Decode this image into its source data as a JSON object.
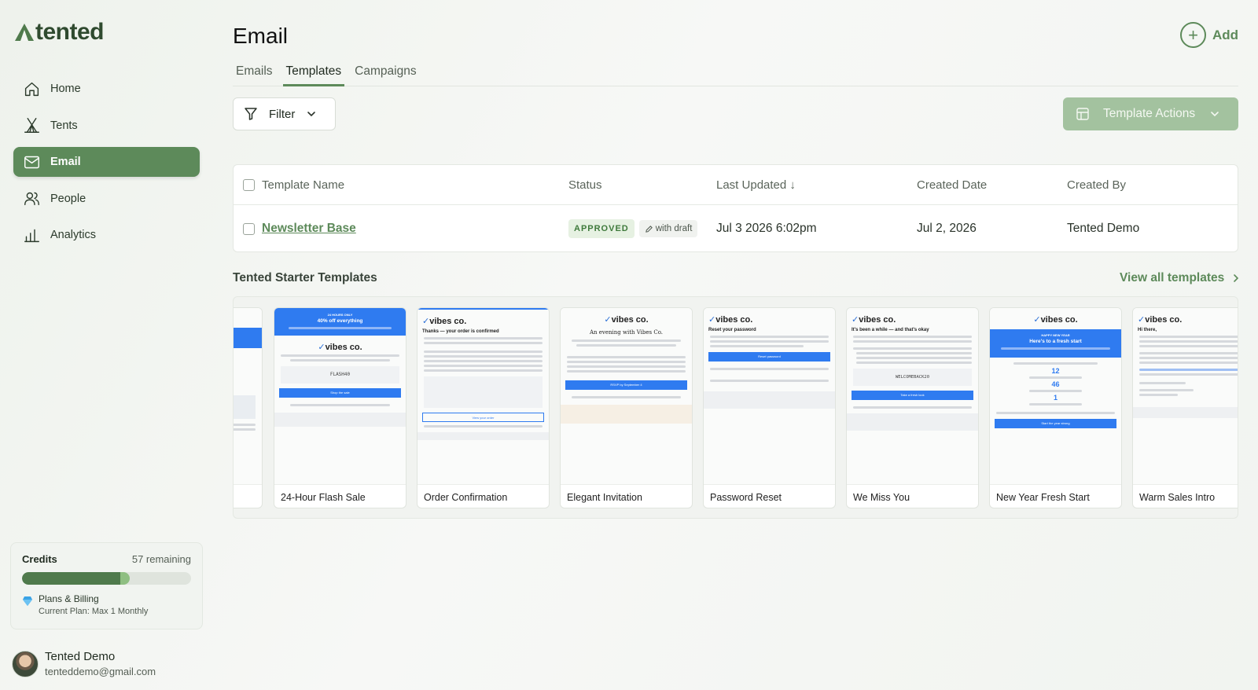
{
  "brand": {
    "name": "tented",
    "accent": "#5d8a5a"
  },
  "sidebar": {
    "items": [
      {
        "label": "Home",
        "icon": "home-icon"
      },
      {
        "label": "Tents",
        "icon": "tent-icon"
      },
      {
        "label": "Email",
        "icon": "mail-icon",
        "active": true
      },
      {
        "label": "People",
        "icon": "people-icon"
      },
      {
        "label": "Analytics",
        "icon": "bar-chart-icon"
      }
    ],
    "credits": {
      "title": "Credits",
      "remaining": "57 remaining",
      "usage_fraction": 0.59,
      "billing_title": "Plans & Billing",
      "billing_plan": "Current Plan: Max 1 Monthly"
    },
    "user": {
      "name": "Tented Demo",
      "email": "tenteddemo@gmail.com"
    }
  },
  "header": {
    "title": "Email",
    "add_label": "Add"
  },
  "tabs": [
    {
      "label": "Emails"
    },
    {
      "label": "Templates",
      "active": true
    },
    {
      "label": "Campaigns"
    }
  ],
  "toolbar": {
    "filter_label": "Filter",
    "actions_label": "Template Actions"
  },
  "table": {
    "columns": [
      "Template Name",
      "Status",
      "Last Updated ↓",
      "Created Date",
      "Created By"
    ],
    "rows": [
      {
        "name": "Newsletter Base",
        "status": "APPROVED",
        "draft": "with draft",
        "last_updated": "Jul 3 2026 6:02pm",
        "created_date": "Jul 2, 2026",
        "created_by": "Tented Demo"
      }
    ]
  },
  "starter": {
    "title": "Tented Starter Templates",
    "view_all": "View all templates",
    "templates": [
      {
        "name": "24-Hour Flash Sale",
        "band_top": "24 HOURS ONLY",
        "band_main": "40% off everything",
        "code": "FLASH40",
        "button": "Shop the sale"
      },
      {
        "name": "Order Confirmation",
        "heading": "Thanks — your order is confirmed",
        "button": "View your order"
      },
      {
        "name": "Elegant Invitation",
        "heading": "An evening with Vibes Co.",
        "button": "RSVP by September 4"
      },
      {
        "name": "Password Reset",
        "heading": "Reset your password",
        "button": "Reset password"
      },
      {
        "name": "We Miss You",
        "heading": "It's been a while — and that's okay",
        "code": "WELCOMEBACK20",
        "button": "Take a fresh look"
      },
      {
        "name": "New Year Fresh Start",
        "band_top": "HAPPY NEW YEAR",
        "band_main": "Here's to a fresh start",
        "numbers": [
          "12",
          "46",
          "1"
        ],
        "button": "Start the year strong"
      },
      {
        "name": "Warm Sales Intro",
        "heading": "Hi there,"
      }
    ],
    "preview_logo": "vibes co."
  }
}
